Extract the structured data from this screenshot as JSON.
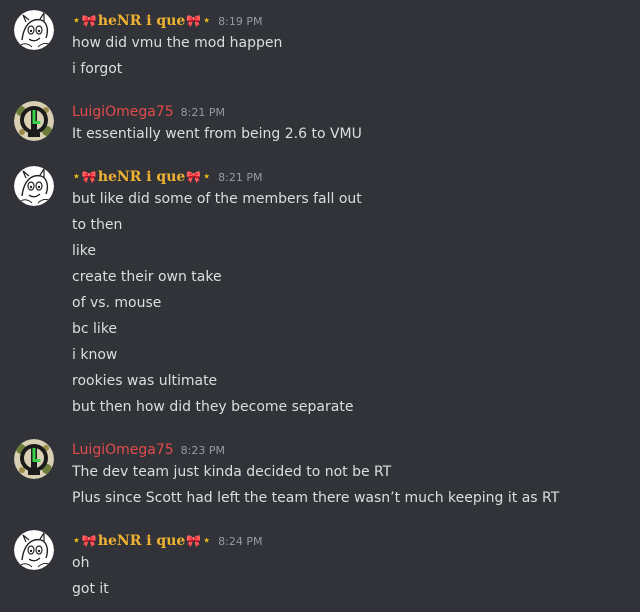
{
  "messages": [
    {
      "author": "henrique",
      "name_prefix": "⭑",
      "name_bow": "🎀",
      "name_text": "heNR i que",
      "name_suffix": "⭑",
      "timestamp": "8:19 PM",
      "lines": [
        "how did vmu the mod happen",
        "i forgot"
      ]
    },
    {
      "author": "luigi",
      "name": "LuigiOmega75",
      "timestamp": "8:21 PM",
      "lines": [
        "It essentially went from being 2.6 to VMU"
      ]
    },
    {
      "author": "henrique",
      "name_prefix": "⭑",
      "name_bow": "🎀",
      "name_text": "heNR i que",
      "name_suffix": "⭑",
      "timestamp": "8:21 PM",
      "lines": [
        "but like did some of the members fall out",
        "to then",
        "like",
        "create their own take",
        "of vs. mouse",
        "bc like",
        "i know",
        "rookies was ultimate",
        "but then how did they become separate"
      ]
    },
    {
      "author": "luigi",
      "name": "LuigiOmega75",
      "timestamp": "8:23 PM",
      "lines": [
        "The dev team just kinda decided to not be RT",
        "Plus since Scott had left the team there wasn’t much keeping it as RT"
      ]
    },
    {
      "author": "henrique",
      "name_prefix": "⭑",
      "name_bow": "🎀",
      "name_text": "heNR i que",
      "name_suffix": "⭑",
      "timestamp": "8:24 PM",
      "lines": [
        "oh",
        "got it"
      ]
    }
  ],
  "colors": {
    "background": "#313338",
    "henrique_name": "#f0b232",
    "luigi_name": "#e24b4b",
    "text": "#dbdee1",
    "timestamp": "#949ba4"
  },
  "icons": {
    "henrique_avatar": "sketch-character-avatar-icon",
    "luigi_avatar": "omega-l-logo-avatar-icon"
  }
}
